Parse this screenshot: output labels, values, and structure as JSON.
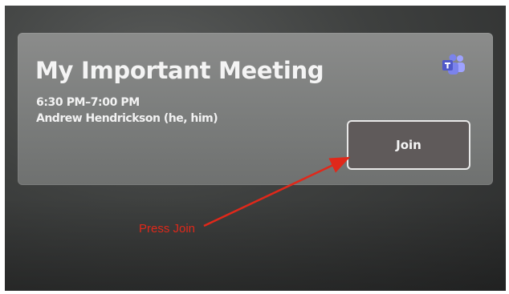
{
  "meeting": {
    "title": "My Important Meeting",
    "time": "6:30 PM–7:00 PM",
    "organizer": "Andrew Hendrickson (he, him)",
    "join_label": "Join",
    "app_icon": "microsoft-teams-icon"
  },
  "annotation": {
    "text": "Press Join",
    "color": "#e0281a"
  },
  "colors": {
    "teams_purple": "#6264a7",
    "teams_light": "#9ea2ff"
  }
}
